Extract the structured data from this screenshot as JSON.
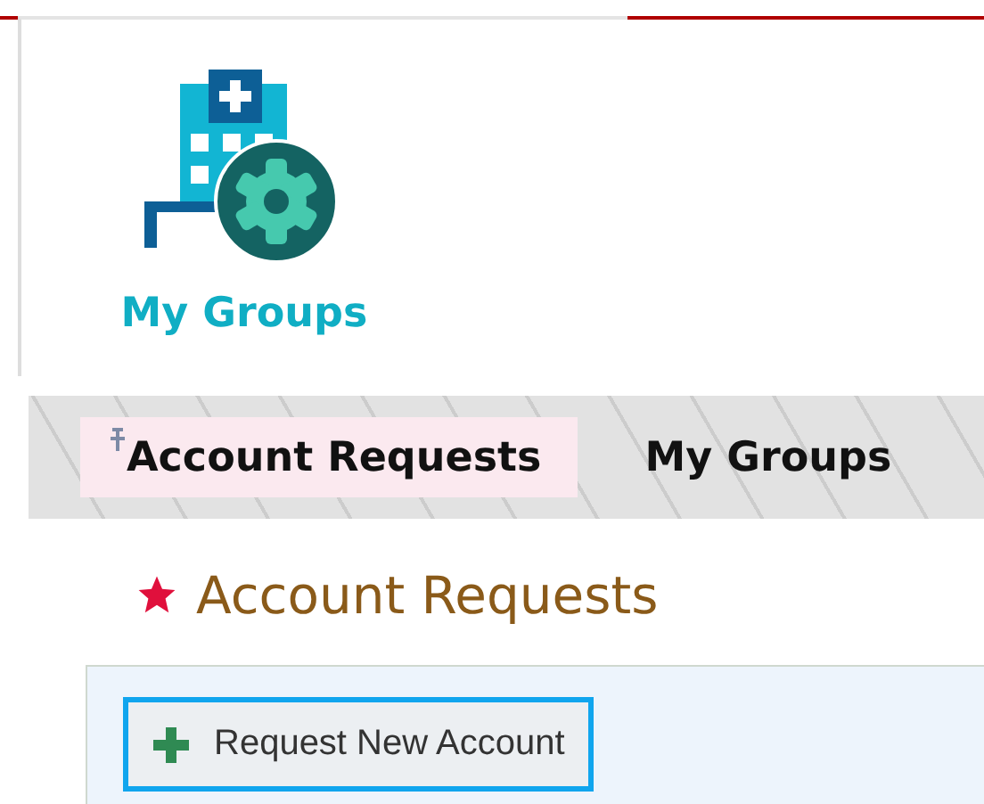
{
  "tile": {
    "label": "My Groups"
  },
  "tabs": [
    {
      "label": "Account Requests",
      "selected": true,
      "pinned": true
    },
    {
      "label": "My Groups",
      "selected": false,
      "pinned": false
    }
  ],
  "page": {
    "title": "Account Requests",
    "pinned": true
  },
  "toolbar": {
    "buttons": [
      "Request New Account"
    ]
  }
}
